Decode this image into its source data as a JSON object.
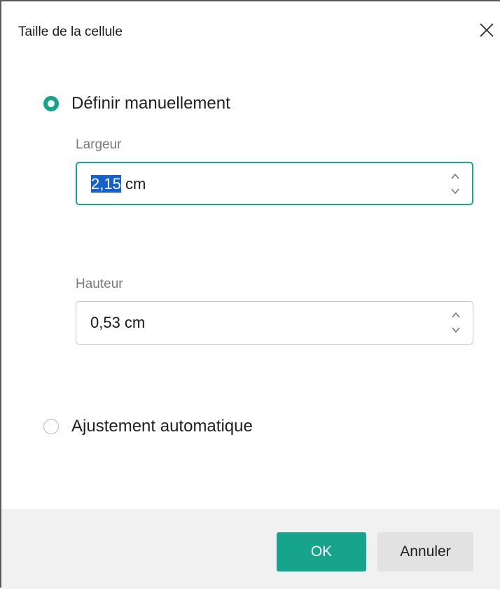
{
  "dialog": {
    "title": "Taille de la cellule",
    "close_icon": "close-icon"
  },
  "options": {
    "manual": {
      "label": "Définir manuellement",
      "selected": true
    },
    "auto": {
      "label": "Ajustement automatique",
      "selected": false
    }
  },
  "width_field": {
    "label": "Largeur",
    "value_selected": "2,15",
    "unit": " cm"
  },
  "height_field": {
    "label": "Hauteur",
    "value": "0,53 cm"
  },
  "buttons": {
    "ok_label": "OK",
    "cancel_label": "Annuler"
  },
  "colors": {
    "accent": "#16a58c",
    "selection": "#1661c8",
    "footer_bg": "#f1f1f1"
  }
}
